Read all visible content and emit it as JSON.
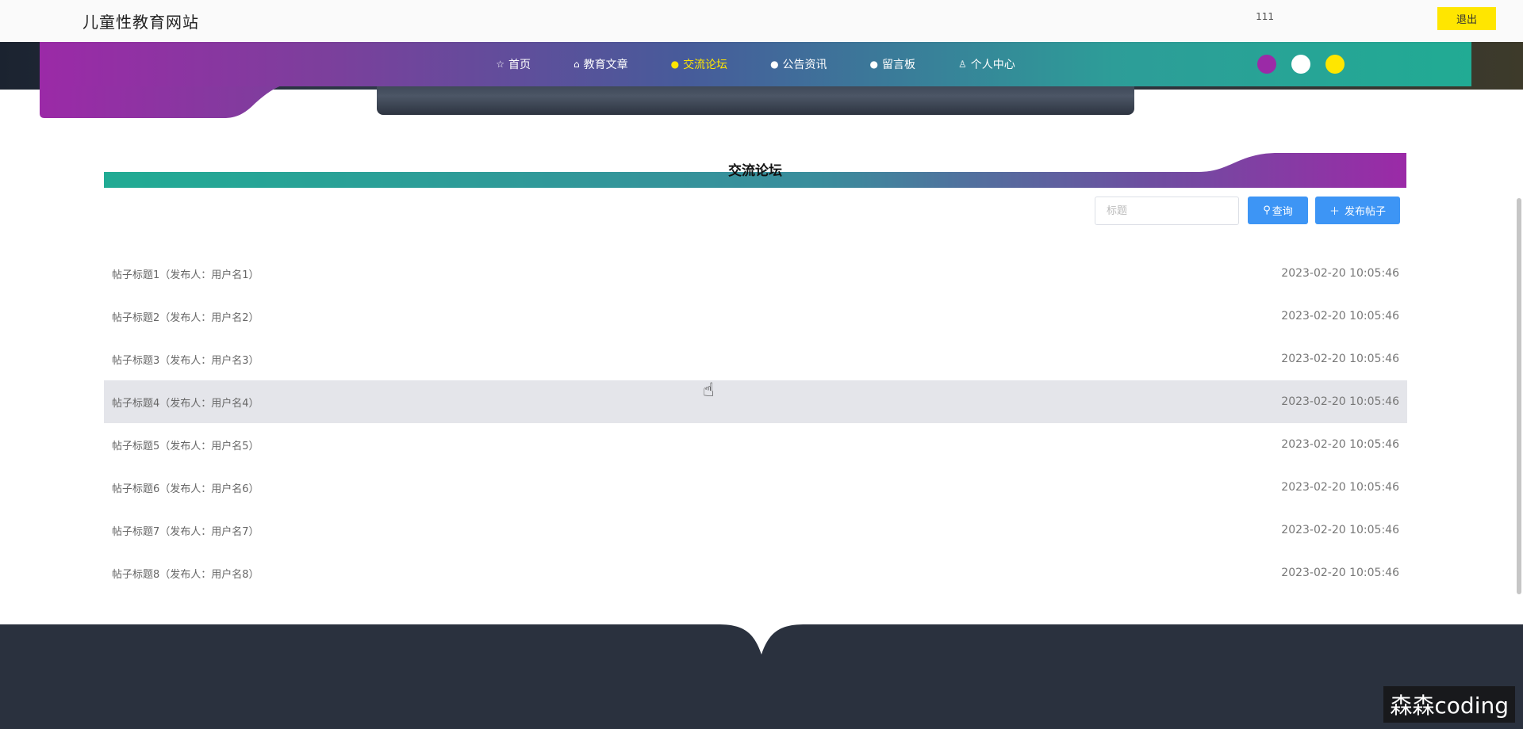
{
  "header": {
    "site_title": "儿童性教育网站",
    "user": "111",
    "logout_label": "退出"
  },
  "nav": {
    "items": [
      {
        "icon": "☆",
        "label": "首页"
      },
      {
        "icon": "⌂",
        "label": "教育文章"
      },
      {
        "icon": "●",
        "label": "交流论坛"
      },
      {
        "icon": "●",
        "label": "公告资讯"
      },
      {
        "icon": "●",
        "label": "留言板"
      },
      {
        "icon": "♙",
        "label": "个人中心"
      }
    ],
    "active_index": 2,
    "theme_colors": [
      "#9b2aa7",
      "#ffffff",
      "#ffe600"
    ]
  },
  "section": {
    "title": "交流论坛"
  },
  "search": {
    "placeholder": "标题",
    "value": "",
    "query_label": "查询",
    "query_icon": "search-icon",
    "post_label": "发布帖子",
    "post_icon": "plus-icon"
  },
  "posts": [
    {
      "title": "帖子标题1（发布人：用户名1）",
      "time": "2023-02-20 10:05:46"
    },
    {
      "title": "帖子标题2（发布人：用户名2）",
      "time": "2023-02-20 10:05:46"
    },
    {
      "title": "帖子标题3（发布人：用户名3）",
      "time": "2023-02-20 10:05:46"
    },
    {
      "title": "帖子标题4（发布人：用户名4）",
      "time": "2023-02-20 10:05:46"
    },
    {
      "title": "帖子标题5（发布人：用户名5）",
      "time": "2023-02-20 10:05:46"
    },
    {
      "title": "帖子标题6（发布人：用户名6）",
      "time": "2023-02-20 10:05:46"
    },
    {
      "title": "帖子标题7（发布人：用户名7）",
      "time": "2023-02-20 10:05:46"
    },
    {
      "title": "帖子标题8（发布人：用户名8）",
      "time": "2023-02-20 10:05:46"
    }
  ],
  "hovered_post_index": 3,
  "watermark": "森森coding",
  "colors": {
    "gradient_purple": "#9b2aa7",
    "gradient_teal": "#21ab94",
    "active_nav": "#ffe600",
    "button_blue": "#3d95f5",
    "footer": "#2a313e"
  }
}
